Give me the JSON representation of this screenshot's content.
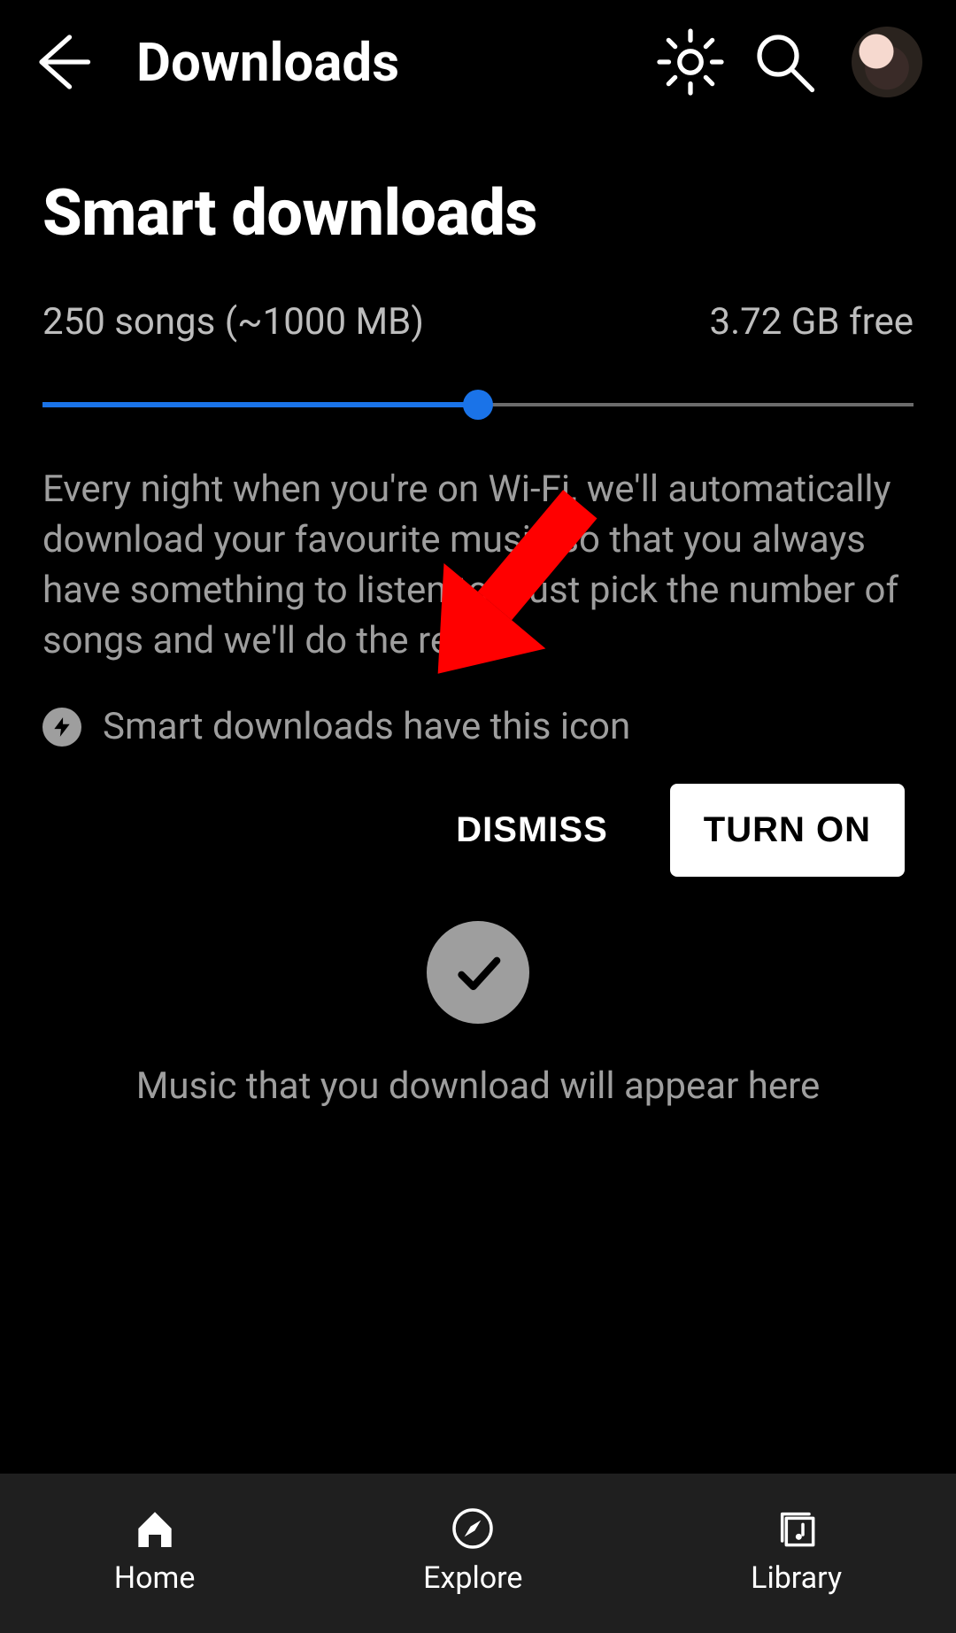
{
  "header": {
    "title": "Downloads"
  },
  "smart": {
    "heading": "Smart downloads",
    "songs_label": "250 songs (~1000 MB)",
    "free_label": "3.72 GB free",
    "slider_percent": 50,
    "description": "Every night when you're on Wi-Fi, we'll automatically download your favourite music so that you always have something to listen to. Just pick the number of songs and we'll do the rest.",
    "icon_hint": "Smart downloads have this icon",
    "dismiss_label": "DISMISS",
    "turn_on_label": "TURN ON"
  },
  "empty": {
    "text": "Music that you download will appear here"
  },
  "nav": {
    "home": "Home",
    "explore": "Explore",
    "library": "Library"
  },
  "colors": {
    "accent": "#1a73e8",
    "arrow": "#ff0000"
  }
}
